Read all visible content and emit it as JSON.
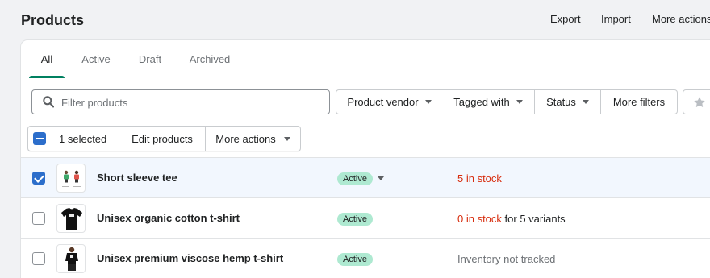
{
  "header": {
    "title": "Products",
    "export_label": "Export",
    "import_label": "Import",
    "more_actions_label": "More actions"
  },
  "tabs": [
    {
      "label": "All",
      "selected": true
    },
    {
      "label": "Active",
      "selected": false
    },
    {
      "label": "Draft",
      "selected": false
    },
    {
      "label": "Archived",
      "selected": false
    }
  ],
  "filters": {
    "search_placeholder": "Filter products",
    "search_value": "",
    "product_vendor_label": "Product vendor",
    "tagged_with_label": "Tagged with",
    "status_label": "Status",
    "more_filters_label": "More filters"
  },
  "bulk_actions": {
    "selected_label": "1 selected",
    "edit_label": "Edit products",
    "more_actions_label": "More actions"
  },
  "products": [
    {
      "name": "Short sleeve tee",
      "status": "Active",
      "status_has_dropdown": true,
      "selected": true,
      "thumbnail": "two-people-tees-image",
      "inventory_main": "5 in stock",
      "inventory_suffix": ""
    },
    {
      "name": "Unisex organic cotton t-shirt",
      "status": "Active",
      "status_has_dropdown": false,
      "selected": false,
      "thumbnail": "black-tshirt-image",
      "inventory_main": "0 in stock",
      "inventory_suffix": " for 5 variants"
    },
    {
      "name": "Unisex premium viscose hemp t-shirt",
      "status": "Active",
      "status_has_dropdown": false,
      "selected": false,
      "thumbnail": "person-in-black-tshirt-image",
      "inventory_main": "Inventory not tracked",
      "inventory_suffix": ""
    }
  ],
  "colors": {
    "accent_green": "#008060",
    "checkbox_blue": "#2c6ecb",
    "badge_active": "#aee9d1",
    "stock_red": "#d72c0d",
    "selected_row_bg": "#f2f7fe"
  }
}
